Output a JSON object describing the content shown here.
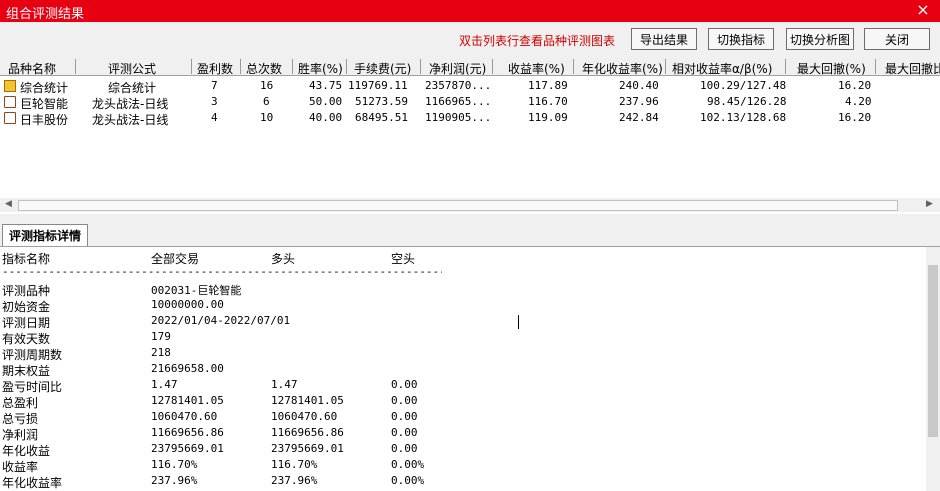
{
  "window": {
    "title": "组合评测结果",
    "close_symbol": "×"
  },
  "toolbar": {
    "hint": "双击列表行查看品种评测图表",
    "buttons": [
      "导出结果",
      "切换指标",
      "切换分析图",
      "关闭"
    ]
  },
  "table": {
    "columns": [
      "品种名称",
      "评测公式",
      "盈利数",
      "总次数",
      "胜率(%)",
      "手续费(元)",
      "净利润(元)",
      "收益率(%)",
      "年化收益率(%)",
      "相对收益率α/β(%)",
      "最大回撤(%)",
      "最大回撤比"
    ],
    "rows": [
      {
        "icon": "folder-icon",
        "name": "综合统计",
        "formula": "综合统计",
        "wins": "7",
        "total": "16",
        "winrate": "43.75",
        "fee": "119769.11",
        "net": "2357870...",
        "ret": "117.89",
        "annual": "240.40",
        "rel": "100.29/127.48",
        "maxdd": "16.20"
      },
      {
        "icon": "document-icon",
        "name": "巨轮智能",
        "formula": "龙头战法-日线",
        "wins": "3",
        "total": "6",
        "winrate": "50.00",
        "fee": "51273.59",
        "net": "1166965...",
        "ret": "116.70",
        "annual": "237.96",
        "rel": "98.45/126.28",
        "maxdd": "4.20"
      },
      {
        "icon": "document-icon",
        "name": "日丰股份",
        "formula": "龙头战法-日线",
        "wins": "4",
        "total": "10",
        "winrate": "40.00",
        "fee": "68495.51",
        "net": "1190905...",
        "ret": "119.09",
        "annual": "242.84",
        "rel": "102.13/128.68",
        "maxdd": "16.20"
      }
    ]
  },
  "detail": {
    "tab_label": "评测指标详情",
    "header": [
      "指标名称",
      "全部交易",
      "多头",
      "空头"
    ],
    "divider": "--------------------------------------------------------------------------------------",
    "rows": [
      [
        "评测品种",
        "002031-巨轮智能",
        "",
        ""
      ],
      [
        "初始资金",
        "10000000.00",
        "",
        ""
      ],
      [
        "评测日期",
        "2022/01/04-2022/07/01",
        "",
        ""
      ],
      [
        "有效天数",
        "179",
        "",
        ""
      ],
      [
        "评测周期数",
        "218",
        "",
        ""
      ],
      [
        "期末权益",
        "21669658.00",
        "",
        ""
      ],
      [
        "盈亏时间比",
        "1.47",
        "1.47",
        "0.00"
      ],
      [
        "总盈利",
        "12781401.05",
        "12781401.05",
        "0.00"
      ],
      [
        "总亏损",
        "1060470.60",
        "1060470.60",
        "0.00"
      ],
      [
        "净利润",
        "11669656.86",
        "11669656.86",
        "0.00"
      ],
      [
        "年化收益",
        "23795669.01",
        "23795669.01",
        "0.00"
      ],
      [
        "收益率",
        "116.70%",
        "116.70%",
        "0.00%"
      ],
      [
        "年化收益率",
        "237.96%",
        "237.96%",
        "0.00%"
      ]
    ]
  },
  "colors": {
    "titlebar": "#e60012",
    "hint_text": "#d00000"
  }
}
